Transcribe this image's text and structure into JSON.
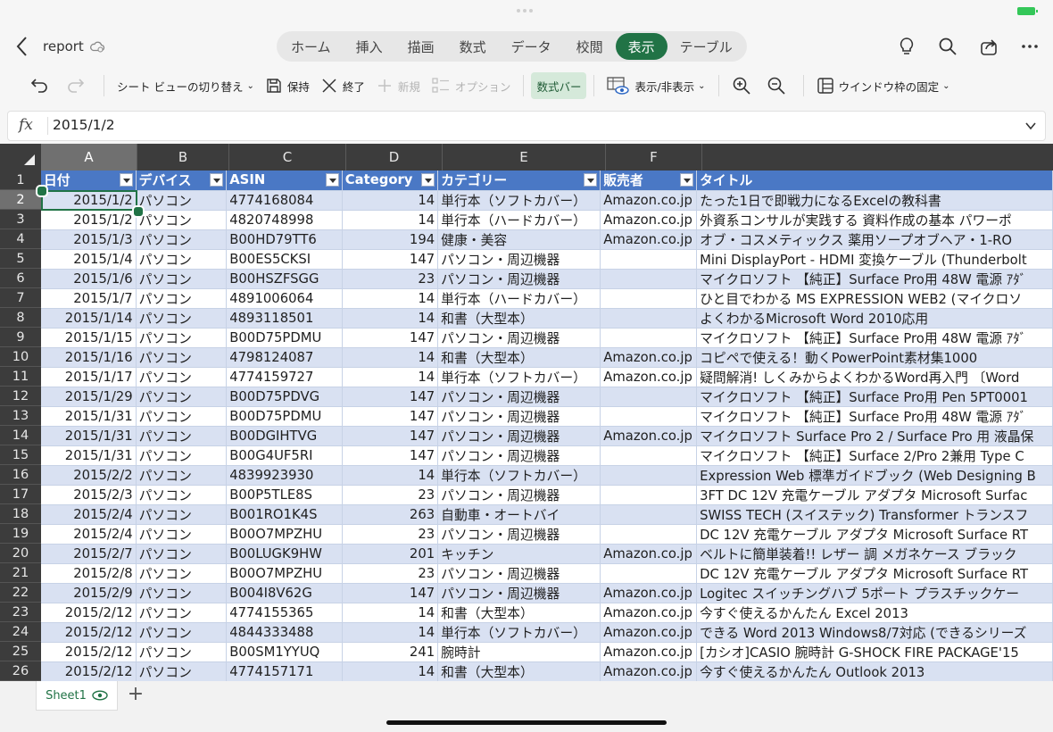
{
  "app": {
    "document_title": "report"
  },
  "ribbon_tabs": [
    {
      "label": "ホーム",
      "active": false
    },
    {
      "label": "挿入",
      "active": false
    },
    {
      "label": "描画",
      "active": false
    },
    {
      "label": "数式",
      "active": false
    },
    {
      "label": "データ",
      "active": false
    },
    {
      "label": "校閲",
      "active": false
    },
    {
      "label": "表示",
      "active": true
    },
    {
      "label": "テーブル",
      "active": false
    }
  ],
  "toolbar": {
    "sheet_view": "シート ビューの切り替え",
    "keep": "保持",
    "exit": "終了",
    "new": "新規",
    "options": "オプション",
    "formula_bar": "数式バー",
    "show_hide": "表示/非表示",
    "freeze_panes": "ウインドウ枠の固定"
  },
  "formula_bar": {
    "fx": "fx",
    "value": "2015/1/2"
  },
  "sheet": {
    "columns": [
      "A",
      "B",
      "C",
      "D",
      "E",
      "F",
      ""
    ],
    "selected_cell": "A2",
    "header": [
      "日付",
      "デバイス",
      "ASIN",
      "Category",
      "カテゴリー",
      "販売者",
      "タイトル"
    ],
    "rows": [
      [
        "2015/1/2",
        "パソコン",
        "4774168084",
        "14",
        "単行本（ソフトカバー）",
        "Amazon.co.jp",
        "たった1日で即戦力になるExcelの教科書"
      ],
      [
        "2015/1/2",
        "パソコン",
        "4820748998",
        "14",
        "単行本（ハードカバー）",
        "Amazon.co.jp",
        "外資系コンサルが実践する 資料作成の基本 パワーポ"
      ],
      [
        "2015/1/3",
        "パソコン",
        "B00HD79TT6",
        "194",
        "健康・美容",
        "Amazon.co.jp",
        "オブ・コスメティックス 薬用ソープオブヘア・1-RO"
      ],
      [
        "2015/1/4",
        "パソコン",
        "B00ES5CKSI",
        "147",
        "パソコン・周辺機器",
        "",
        "Mini DisplayPort - HDMI 変換ケーブル (Thunderbolt"
      ],
      [
        "2015/1/6",
        "パソコン",
        "B00HSZFSGG",
        "23",
        "パソコン・周辺機器",
        "",
        "マイクロソフト 【純正】Surface Pro用 48W 電源 ｱﾀﾞ"
      ],
      [
        "2015/1/7",
        "パソコン",
        "4891006064",
        "14",
        "単行本（ハードカバー）",
        "",
        "ひと目でわかる MS EXPRESSION WEB2 (マイクロソ"
      ],
      [
        "2015/1/14",
        "パソコン",
        "4893118501",
        "14",
        "和書（大型本）",
        "",
        "よくわかるMicrosoft Word 2010応用"
      ],
      [
        "2015/1/15",
        "パソコン",
        "B00D75PDMU",
        "147",
        "パソコン・周辺機器",
        "",
        "マイクロソフト 【純正】Surface Pro用 48W 電源 ｱﾀﾞ"
      ],
      [
        "2015/1/16",
        "パソコン",
        "4798124087",
        "14",
        "和書（大型本）",
        "Amazon.co.jp",
        "コピペで使える！動くPowerPoint素材集1000"
      ],
      [
        "2015/1/17",
        "パソコン",
        "4774159727",
        "14",
        "単行本（ソフトカバー）",
        "Amazon.co.jp",
        "疑問解消! しくみからよくわかるWord再入門 〔Word"
      ],
      [
        "2015/1/29",
        "パソコン",
        "B00D75PDVG",
        "147",
        "パソコン・周辺機器",
        "",
        "マイクロソフト 【純正】Surface Pro用 Pen 5PT0001"
      ],
      [
        "2015/1/31",
        "パソコン",
        "B00D75PDMU",
        "147",
        "パソコン・周辺機器",
        "",
        "マイクロソフト 【純正】Surface Pro用 48W 電源 ｱﾀﾞ"
      ],
      [
        "2015/1/31",
        "パソコン",
        "B00DGIHTVG",
        "147",
        "パソコン・周辺機器",
        "Amazon.co.jp",
        "マイクロソフト Surface Pro 2 / Surface Pro 用 液晶保"
      ],
      [
        "2015/1/31",
        "パソコン",
        "B00G4UF5RI",
        "147",
        "パソコン・周辺機器",
        "",
        "マイクロソフト 【純正】Surface 2/Pro 2兼用 Type C"
      ],
      [
        "2015/2/2",
        "パソコン",
        "4839923930",
        "14",
        "単行本（ソフトカバー）",
        "",
        "Expression Web 標準ガイドブック (Web Designing B"
      ],
      [
        "2015/2/3",
        "パソコン",
        "B00P5TLE8S",
        "23",
        "パソコン・周辺機器",
        "",
        "3FT DC 12V 充電ケーブル アダプタ Microsoft Surfac"
      ],
      [
        "2015/2/4",
        "パソコン",
        "B001RO1K4S",
        "263",
        "自動車・オートバイ",
        "",
        "SWISS TECH (スイステック) Transformer トランスフ"
      ],
      [
        "2015/2/4",
        "パソコン",
        "B00O7MPZHU",
        "23",
        "パソコン・周辺機器",
        "",
        "DC 12V 充電ケーブル アダプタ Microsoft Surface RT"
      ],
      [
        "2015/2/7",
        "パソコン",
        "B00LUGK9HW",
        "201",
        "キッチン",
        "Amazon.co.jp",
        "ベルトに簡単装着!! レザー 調 メガネケース ブラック"
      ],
      [
        "2015/2/8",
        "パソコン",
        "B00O7MPZHU",
        "23",
        "パソコン・周辺機器",
        "",
        "DC 12V 充電ケーブル アダプタ Microsoft Surface RT"
      ],
      [
        "2015/2/9",
        "パソコン",
        "B004I8V62G",
        "147",
        "パソコン・周辺機器",
        "Amazon.co.jp",
        "Logitec スイッチングハブ 5ポート プラスチックケー"
      ],
      [
        "2015/2/12",
        "パソコン",
        "4774155365",
        "14",
        "和書（大型本）",
        "Amazon.co.jp",
        "今すぐ使えるかんたん Excel 2013"
      ],
      [
        "2015/2/12",
        "パソコン",
        "4844333488",
        "14",
        "単行本（ソフトカバー）",
        "Amazon.co.jp",
        "できる Word 2013 Windows8/7対応 (できるシリーズ"
      ],
      [
        "2015/2/12",
        "パソコン",
        "B00SM1YYUQ",
        "241",
        "腕時計",
        "Amazon.co.jp",
        "[カシオ]CASIO 腕時計 G-SHOCK FIRE PACKAGE'15"
      ],
      [
        "2015/2/12",
        "パソコン",
        "4774157171",
        "14",
        "和書（大型本）",
        "Amazon.co.jp",
        "今すぐ使えるかんたん Outlook 2013"
      ]
    ]
  },
  "sheet_tabs": [
    {
      "label": "Sheet1",
      "active": true
    }
  ],
  "colors": {
    "accent": "#217346",
    "table_header": "#4a78c5",
    "band": "#d9e1f2",
    "grid_header": "#3c3c3c"
  }
}
